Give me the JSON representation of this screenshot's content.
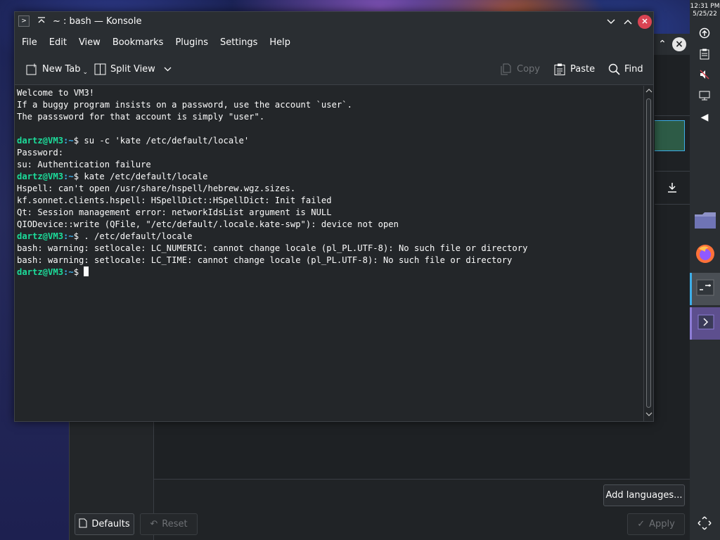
{
  "settings": {
    "add_languages_label": "Add languages...",
    "defaults_label": "Defaults",
    "reset_label": "Reset",
    "apply_label": "Apply"
  },
  "panel": {
    "time": "12:31 PM",
    "date": "5/25/22"
  },
  "konsole": {
    "title": "~ : bash — Konsole",
    "menu": [
      "File",
      "Edit",
      "View",
      "Bookmarks",
      "Plugins",
      "Settings",
      "Help"
    ],
    "toolbar": {
      "new_tab": "New Tab",
      "split_view": "Split View",
      "copy": "Copy",
      "paste": "Paste",
      "find": "Find"
    },
    "terminal": {
      "prompt_user": "dartz@VM3",
      "prompt_path": ":~",
      "prompt_symbol": "$",
      "lines": [
        "Welcome to VM3!",
        "If a buggy program insists on a password, use the account `user`.",
        "The passsword for that account is simply \"user\".",
        "",
        "",
        "Password:",
        "su: Authentication failure",
        "",
        "Hspell: can't open /usr/share/hspell/hebrew.wgz.sizes.",
        "kf.sonnet.clients.hspell: HSpellDict::HSpellDict: Init failed",
        "Qt: Session management error: networkIdsList argument is NULL",
        "QIODevice::write (QFile, \"/etc/default/.locale.kate-swp\"): device not open",
        "",
        "bash: warning: setlocale: LC_NUMERIC: cannot change locale (pl_PL.UTF-8): No such file or directory",
        "bash: warning: setlocale: LC_TIME: cannot change locale (pl_PL.UTF-8): No such file or directory",
        ""
      ],
      "commands": {
        "cmd1": " su -c 'kate /etc/default/locale'",
        "cmd2": " kate /etc/default/locale",
        "cmd3": " . /etc/default/locale",
        "cmd4": " "
      }
    }
  },
  "icons": {
    "app": "konsole-icon",
    "keep_above": "keep-above-icon",
    "minimize": "chevron-down-icon",
    "maximize": "chevron-up-icon",
    "close": "close-icon"
  },
  "colors": {
    "prompt_user": "#1cdc9a",
    "prompt_path": "#3daee9",
    "close": "#da4453",
    "accent": "#3daee9"
  }
}
